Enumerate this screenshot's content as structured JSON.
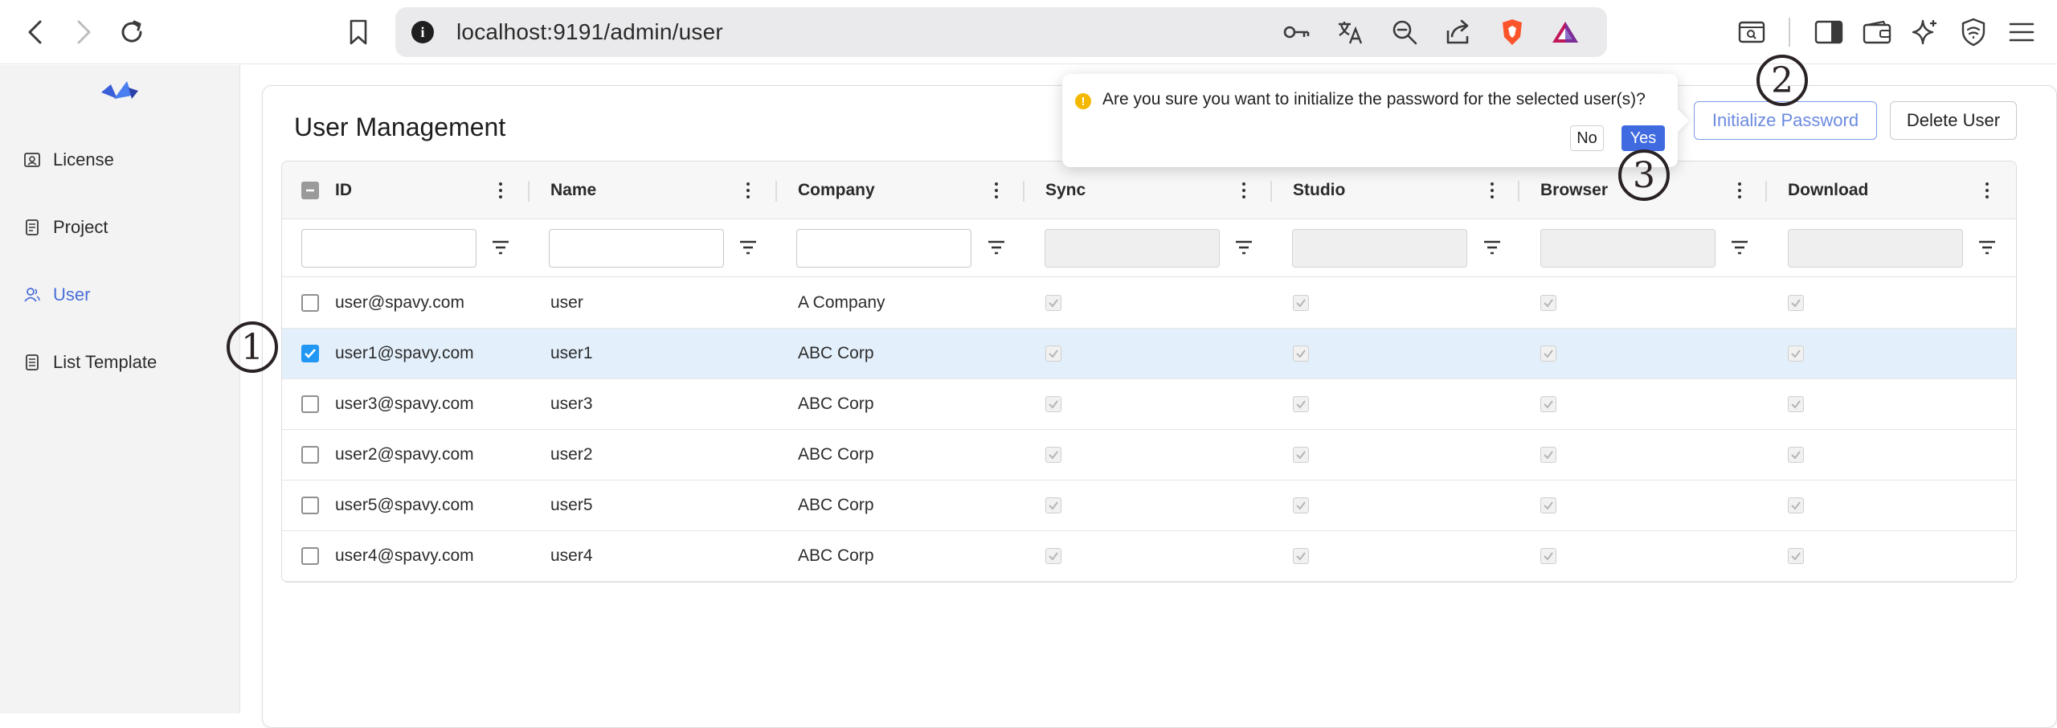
{
  "browser": {
    "url": "localhost:9191/admin/user",
    "toolbar_icons": [
      "back-icon",
      "forward-icon",
      "reload-icon",
      "bookmark-icon",
      "site-info-icon",
      "key-icon",
      "translate-icon",
      "zoom-out-icon",
      "share-icon",
      "brave-shield-icon",
      "brave-rewards-icon",
      "search-tabs-icon",
      "sidebar-icon",
      "wallet-icon",
      "leo-ai-icon",
      "vpn-icon",
      "menu-icon"
    ]
  },
  "sidebar": {
    "items": [
      {
        "label": "License",
        "icon": "license-icon"
      },
      {
        "label": "Project",
        "icon": "project-icon"
      },
      {
        "label": "User",
        "icon": "user-icon"
      },
      {
        "label": "List Template",
        "icon": "list-template-icon"
      }
    ],
    "active": "User"
  },
  "main": {
    "title": "User Management",
    "buttons": {
      "initialize_password": "Initialize Password",
      "delete_user": "Delete User"
    }
  },
  "popconfirm": {
    "message": "Are you sure you want to initialize the password for the selected user(s)?",
    "no_label": "No",
    "yes_label": "Yes"
  },
  "grid": {
    "columns": [
      "ID",
      "Name",
      "Company",
      "Sync",
      "Studio",
      "Browser",
      "Download"
    ],
    "rows": [
      {
        "id": "user@spavy.com",
        "name": "user",
        "company": "A Company",
        "selected": false
      },
      {
        "id": "user1@spavy.com",
        "name": "user1",
        "company": "ABC Corp",
        "selected": true
      },
      {
        "id": "user3@spavy.com",
        "name": "user3",
        "company": "ABC Corp",
        "selected": false
      },
      {
        "id": "user2@spavy.com",
        "name": "user2",
        "company": "ABC Corp",
        "selected": false
      },
      {
        "id": "user5@spavy.com",
        "name": "user5",
        "company": "ABC Corp",
        "selected": false
      },
      {
        "id": "user4@spavy.com",
        "name": "user4",
        "company": "ABC Corp",
        "selected": false
      }
    ]
  },
  "annotations": [
    "1",
    "2",
    "3"
  ],
  "colors": {
    "accent": "#4a6fd8",
    "selected_row": "#e3f0fb",
    "checkbox_checked": "#2196f3",
    "warning": "#f5b800",
    "yes_button": "#3f6ae0"
  }
}
